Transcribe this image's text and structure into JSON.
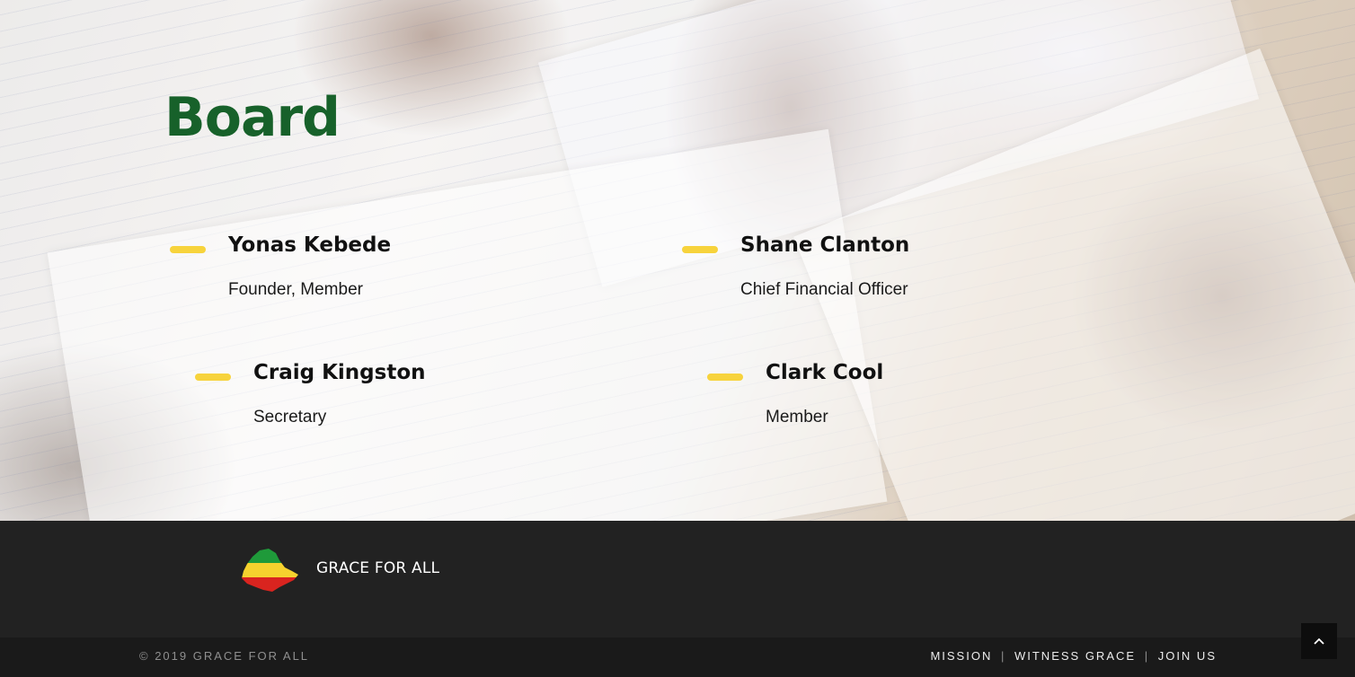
{
  "board": {
    "title": "Board",
    "members": [
      {
        "name": "Yonas Kebede",
        "role": "Founder, Member"
      },
      {
        "name": "Shane Clanton",
        "role": "Chief Financial Officer"
      },
      {
        "name": "Craig Kingston",
        "role": "Secretary"
      },
      {
        "name": "Clark Cool",
        "role": "Member"
      }
    ]
  },
  "footer": {
    "brand": "GRACE FOR ALL",
    "copyright": "© 2019 GRACE FOR ALL",
    "nav": [
      "MISSION",
      "WITNESS GRACE",
      "JOIN US"
    ],
    "separator": "|",
    "scroll_top_icon": "chevron-up-icon"
  },
  "colors": {
    "title_green": "#17612a",
    "accent_yellow": "#f7d33c",
    "flag_green": "#1f9a3a",
    "flag_yellow": "#f6d22e",
    "flag_red": "#d9241f",
    "footer_bg": "#222222",
    "footer_bottom_bg": "#1a1a1a"
  }
}
